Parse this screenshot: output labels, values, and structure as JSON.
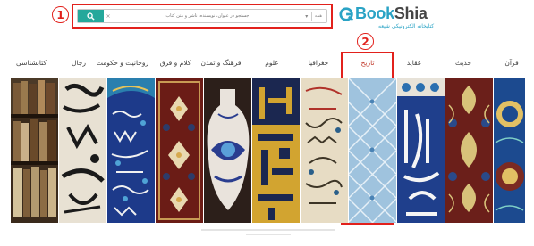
{
  "header": {
    "marker_1": "1",
    "search": {
      "placeholder": "جستجو در عنوان، نویسنده، ناشر و متن کتاب",
      "scope": "همه",
      "button_icon": "search-icon"
    },
    "logo": {
      "book": "Book",
      "shia": "Shia",
      "subtitle": "کتابخانه الکترونیکی شیعه"
    }
  },
  "nav": {
    "marker_2": "2",
    "items": [
      {
        "label": "قرآن"
      },
      {
        "label": "حدیث"
      },
      {
        "label": "عقاید"
      },
      {
        "label": "تاریخ",
        "active": true
      },
      {
        "label": "جغرافیا"
      },
      {
        "label": "علوم"
      },
      {
        "label": "فرهنگ و تمدن"
      },
      {
        "label": "کلام و فرق"
      },
      {
        "label": "روحانیت و حکومت"
      },
      {
        "label": "رجال"
      },
      {
        "label": "کتابشناسی"
      }
    ]
  },
  "banners": [
    "book-spines",
    "arabic-calligraphy",
    "blue-tile-inscription",
    "persian-carpet",
    "blue-ceramic-vase",
    "kufic-gold-panel",
    "illuminated-manuscript",
    "blue-lattice-tile",
    "white-calligraphy-tile",
    "arabesque-ornament",
    "tile-medallion"
  ],
  "colors": {
    "accent": "#25a89b",
    "marker": "#e2211c",
    "logo_blue": "#2aa3c5"
  }
}
